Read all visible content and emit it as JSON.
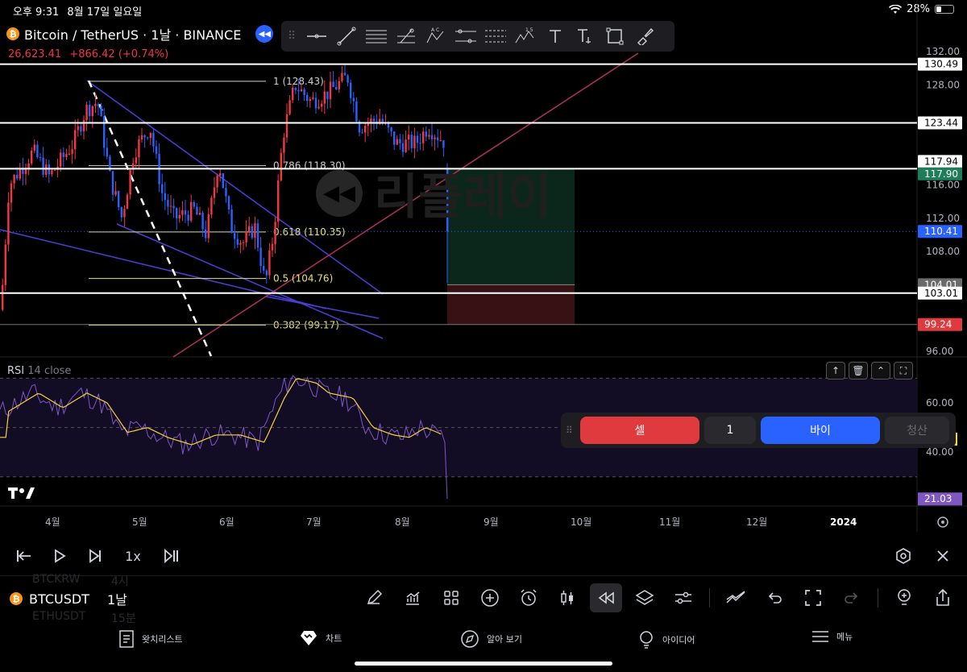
{
  "status_bar": {
    "time": "오후 9:31",
    "date": "8월 17일 일요일",
    "battery": "28%",
    "battery_level": 0.28
  },
  "symbol": {
    "name": "Bitcoin / TetherUS · 1날 · BINANCE",
    "price": "26,623.41",
    "change": "+866.42 (+0.74%)"
  },
  "drawing_tools": [
    "horizontal-line",
    "trend-line",
    "parallel-channel",
    "pitchfork",
    "abcd-pattern",
    "xabcd-pattern",
    "fib-retracement",
    "elliott-wave",
    "text",
    "anchored-text",
    "rectangle",
    "brush"
  ],
  "drawing_tool_superscripts": {
    "abcd": "A C",
    "elliott": "1 5"
  },
  "watermark": "리플레이",
  "chart_data": {
    "type": "candlestick",
    "price_axis": {
      "ticks": [
        "132.00",
        "128.00",
        "116.00",
        "112.00",
        "108.00",
        "96.00"
      ],
      "ylim": [
        96,
        132
      ]
    },
    "time_axis": {
      "ticks": [
        "4월",
        "5월",
        "6월",
        "7월",
        "8월",
        "9월",
        "10월",
        "11월",
        "12월",
        "2024"
      ]
    },
    "horizontal_lines": [
      "130.49",
      "123.44",
      "117.94",
      "103.01"
    ],
    "price_labels": [
      {
        "value": "130.49",
        "style": "white"
      },
      {
        "value": "123.44",
        "style": "white"
      },
      {
        "value": "117.94",
        "style": "white"
      },
      {
        "value": "117.90",
        "style": "green"
      },
      {
        "value": "110.41",
        "style": "blue"
      },
      {
        "value": "104.01",
        "style": "gray"
      },
      {
        "value": "103.01",
        "style": "white"
      },
      {
        "value": "99.24",
        "style": "red"
      }
    ],
    "fib_levels": [
      {
        "ratio": "1",
        "price": "128.43",
        "label": "1 (128.43)"
      },
      {
        "ratio": "0.786",
        "price": "118.30",
        "label": "0.786 (118.30)"
      },
      {
        "ratio": "0.618",
        "price": "110.35",
        "label": "0.618 (110.35)"
      },
      {
        "ratio": "0.5",
        "price": "104.76",
        "label": "0.5 (104.76)"
      },
      {
        "ratio": "0.382",
        "price": "99.17",
        "label": "0.382 (99.17)"
      }
    ],
    "position": {
      "entry": 104.01,
      "target": 117.9,
      "stop": 99.24
    },
    "rsi": {
      "ticks": [
        "60.00",
        "40.00"
      ],
      "current": "21.03",
      "levels": [
        70,
        50,
        30
      ]
    },
    "colors": {
      "up": "#f23645",
      "down": "#2962ff",
      "rsi": "#7e57c2",
      "rsi_ma": "#f5d33a",
      "fib_text": "#e8e07a"
    }
  },
  "rsi_panel": {
    "title": "RSI",
    "params": "14 close"
  },
  "trade_panel": {
    "sell": "셀",
    "quantity": "1",
    "buy": "바이",
    "close": "청산"
  },
  "replay": {
    "speed": "1x"
  },
  "bottom": {
    "symbol": "BTCUSDT",
    "timeframe": "1날",
    "ghost1": "BTCKRW",
    "ghost1_tf": "4시",
    "ghost2": "ETHUSDT",
    "ghost2_tf": "15분"
  },
  "tabs": [
    "왓치리스트",
    "차트",
    "알아 보기",
    "아이디어",
    "메뉴"
  ]
}
